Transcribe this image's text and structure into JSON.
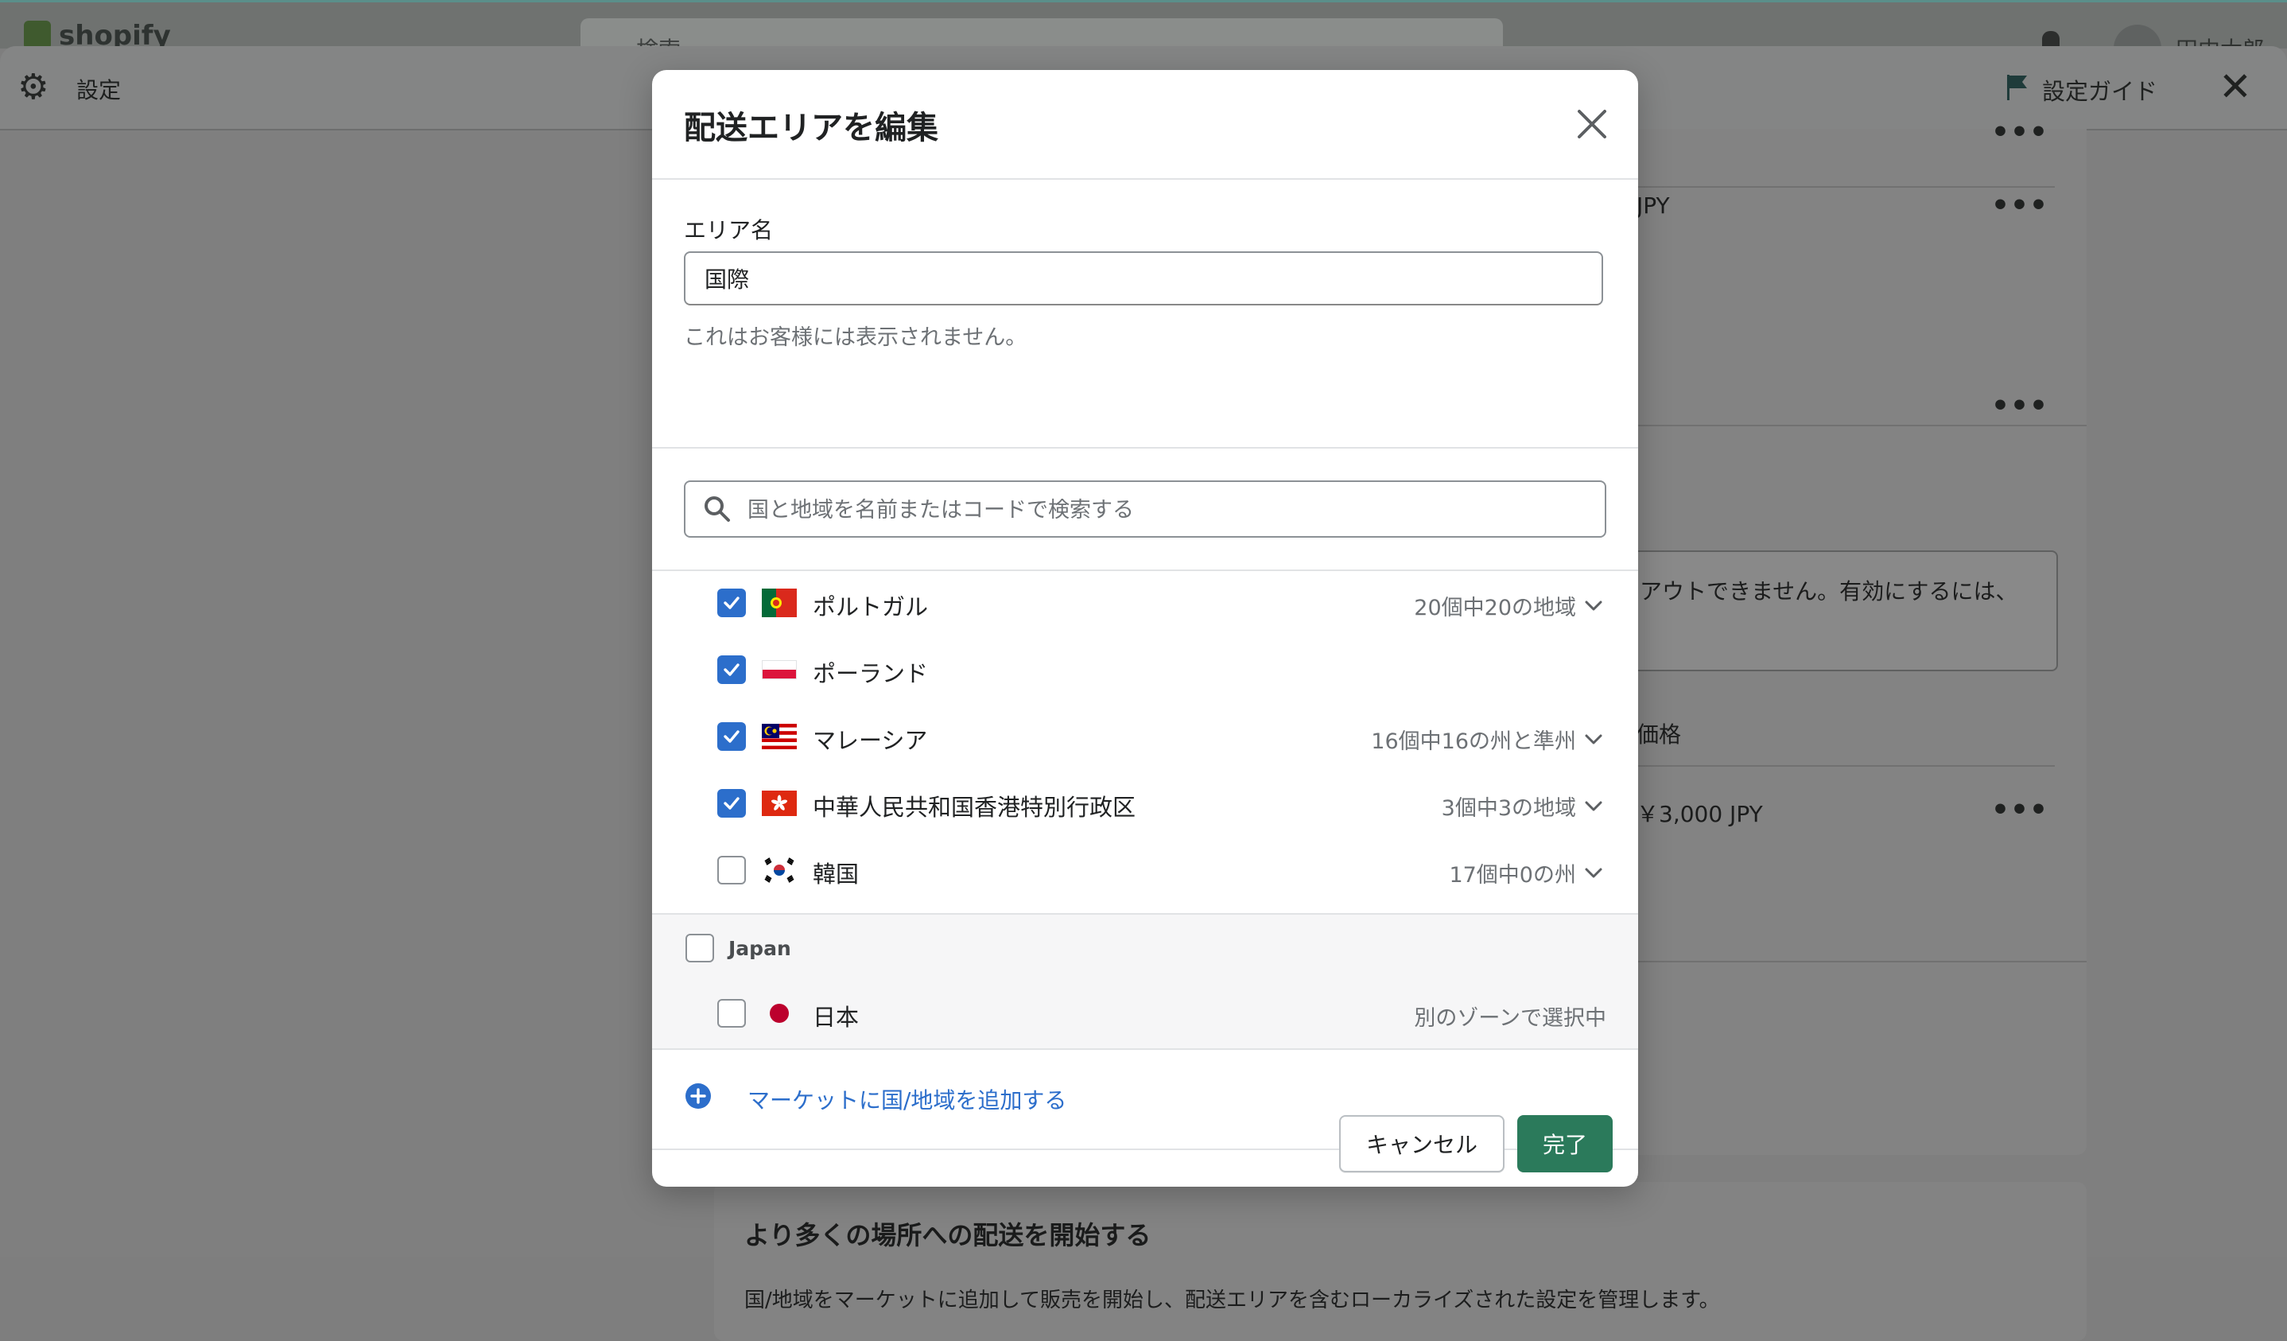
{
  "app": {
    "brand": "shopify",
    "search_placeholder": "検索",
    "user_name": "田中太郎"
  },
  "settings": {
    "title": "設定",
    "guide_label": "設定ガイド"
  },
  "background": {
    "currency_1": "JPY",
    "notice_text": "アウトできません。有効にするには、",
    "price_header": "価格",
    "price_value": "￥3,000 JPY",
    "section_heading": "より多くの場所への配送を開始する",
    "section_text": "国/地域をマーケットに追加して販売を開始し、配送エリアを含むローカライズされた設定を管理します。"
  },
  "modal": {
    "title": "配送エリアを編集",
    "area_name_label": "エリア名",
    "area_name_value": "国際",
    "area_name_help": "これはお客様には表示されません。",
    "search_placeholder": "国と地域を名前またはコードで検索する",
    "countries": [
      {
        "name": "ポルトガル",
        "checked": true,
        "flag": "portugal-flag",
        "region_info": "20個中20の地域"
      },
      {
        "name": "ポーランド",
        "checked": true,
        "flag": "poland-flag",
        "region_info": ""
      },
      {
        "name": "マレーシア",
        "checked": true,
        "flag": "malaysia-flag",
        "region_info": "16個中16の州と準州"
      },
      {
        "name": "中華人民共和国香港特別行政区",
        "checked": true,
        "flag": "hong-kong-flag",
        "region_info": "3個中3の地域"
      },
      {
        "name": "韓国",
        "checked": false,
        "flag": "south-korea-flag",
        "region_info": "17個中0の州"
      }
    ],
    "group": {
      "label": "Japan",
      "country": "日本",
      "note": "別のゾーンで選択中"
    },
    "add_link": "マーケットに国/地域を追加する",
    "cancel_label": "キャンセル",
    "done_label": "完了"
  },
  "colors": {
    "accent_blue": "#2c6ecb",
    "primary_green": "#2b7a5b"
  }
}
